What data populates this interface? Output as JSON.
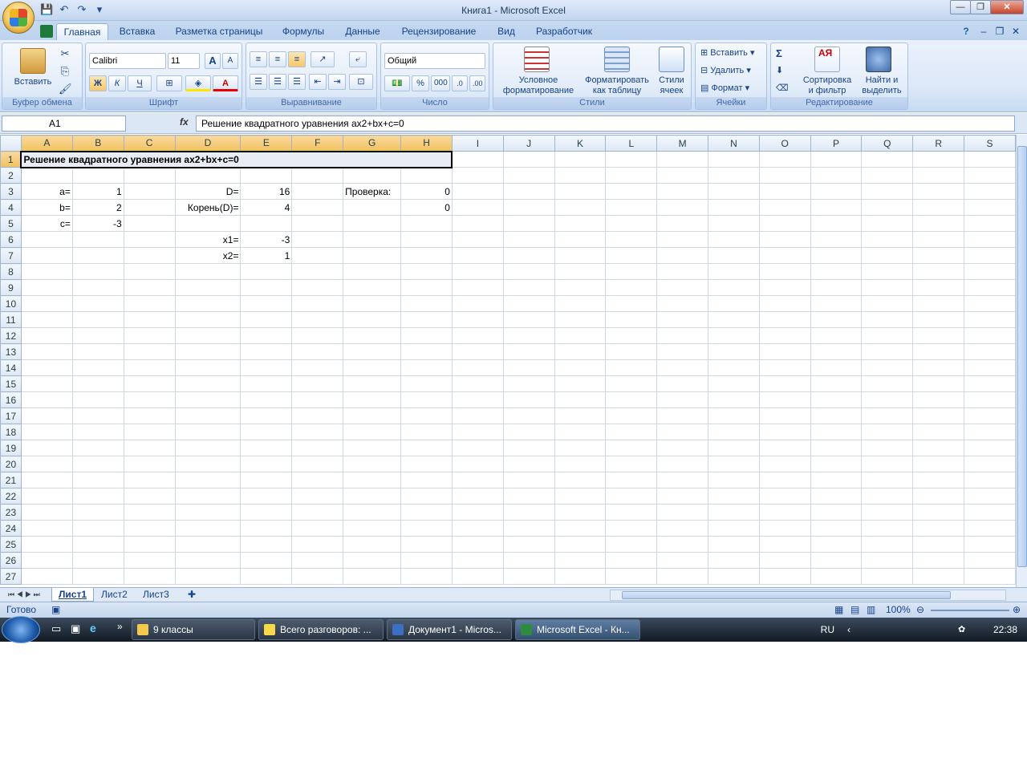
{
  "window": {
    "title": "Книга1 - Microsoft Excel"
  },
  "qat": {
    "save": "💾",
    "undo": "↶",
    "redo": "↷",
    "customize": "▾"
  },
  "tabs": [
    "Главная",
    "Вставка",
    "Разметка страницы",
    "Формулы",
    "Данные",
    "Рецензирование",
    "Вид",
    "Разработчик"
  ],
  "ribbon": {
    "clipboard": {
      "label": "Буфер обмена",
      "paste": "Вставить"
    },
    "font": {
      "label": "Шрифт",
      "name": "Calibri",
      "size": "11",
      "bold": "Ж",
      "italic": "К",
      "underline": "Ч",
      "grow": "A",
      "shrink": "A"
    },
    "alignment": {
      "label": "Выравнивание"
    },
    "number": {
      "label": "Число",
      "format": "Общий",
      "percent": "%",
      "thousands": "000"
    },
    "styles": {
      "label": "Стили",
      "cond_l1": "Условное",
      "cond_l2": "форматирование",
      "table_l1": "Форматировать",
      "table_l2": "как таблицу",
      "cell_l1": "Стили",
      "cell_l2": "ячеек"
    },
    "cells": {
      "label": "Ячейки",
      "insert": "Вставить",
      "delete": "Удалить",
      "format": "Формат"
    },
    "editing": {
      "label": "Редактирование",
      "sigma": "Σ",
      "sort_l1": "Сортировка",
      "sort_l2": "и фильтр",
      "find_l1": "Найти и",
      "find_l2": "выделить"
    }
  },
  "formula_bar": {
    "name_box": "A1",
    "fx": "fx",
    "content": "Решение квадратного уравнения ax2+bx+c=0"
  },
  "columns": [
    "A",
    "B",
    "C",
    "D",
    "E",
    "F",
    "G",
    "H",
    "I",
    "J",
    "K",
    "L",
    "M",
    "N",
    "O",
    "P",
    "Q",
    "R",
    "S"
  ],
  "rows": [
    [
      "Решение квадратного уравнения ax2+bx+c=0",
      "",
      "",
      "",
      "",
      "",
      "",
      ""
    ],
    [
      "",
      "",
      "",
      "",
      "",
      "",
      "",
      ""
    ],
    [
      "a=",
      "1",
      "",
      "D=",
      "16",
      "",
      "Проверка:",
      "0"
    ],
    [
      "b=",
      "2",
      "",
      "Корень(D)=",
      "4",
      "",
      "",
      "0"
    ],
    [
      "c=",
      "-3",
      "",
      "",
      "",
      "",
      "",
      ""
    ],
    [
      "",
      "",
      "",
      "x1=",
      "-3",
      "",
      "",
      ""
    ],
    [
      "",
      "",
      "",
      "x2=",
      "1",
      "",
      "",
      ""
    ]
  ],
  "row_count": 27,
  "sheets": [
    "Лист1",
    "Лист2",
    "Лист3"
  ],
  "status": {
    "ready": "Готово",
    "zoom": "100%"
  },
  "taskbar": {
    "items": [
      "9 классы",
      "Всего разговоров: ...",
      "Документ1 - Micros...",
      "Microsoft Excel - Кн..."
    ],
    "lang": "RU",
    "time": "22:38"
  }
}
